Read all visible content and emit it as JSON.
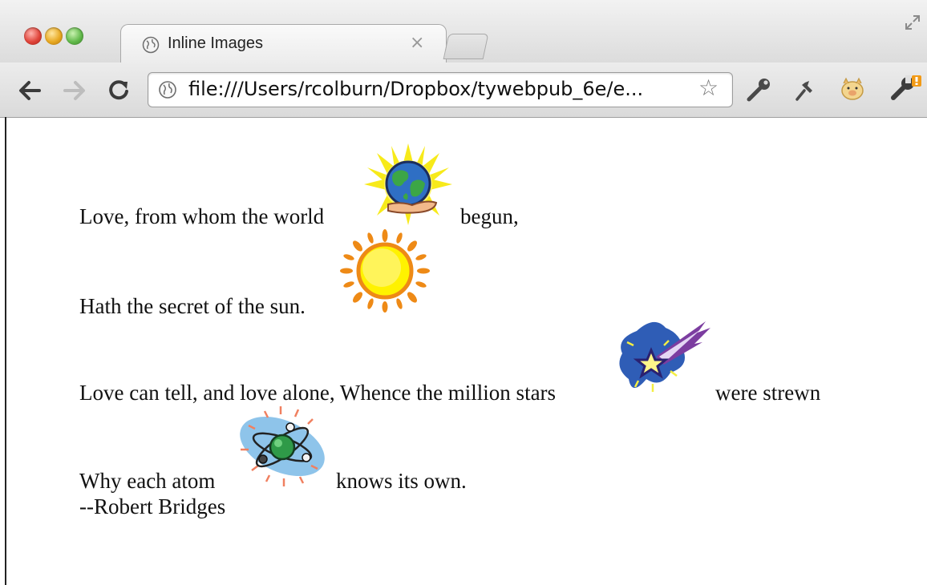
{
  "browser": {
    "tab_title": "Inline Images",
    "tab_close": "×",
    "url": "file:///Users/rcolburn/Dropbox/tywebpub_6e/e...",
    "nav_icons": [
      "back-arrow-icon",
      "forward-arrow-icon",
      "reload-icon"
    ],
    "extension_icons": [
      "wrench-key-icon",
      "pin-icon",
      "pig-extension-icon",
      "settings-wrench-icon"
    ]
  },
  "poem": {
    "line1_a": "Love, from whom the world",
    "line1_b": "begun,",
    "line2": "Hath the secret of the sun.",
    "line3_a": "Love can tell, and love alone, Whence the million stars",
    "line3_b": "were strewn",
    "line4_a": "Why each atom",
    "line4_b": "knows its own.",
    "attribution": "--Robert Bridges"
  },
  "images": [
    "globe-in-hand-icon",
    "sun-icon",
    "shooting-star-icon",
    "atom-icon"
  ]
}
